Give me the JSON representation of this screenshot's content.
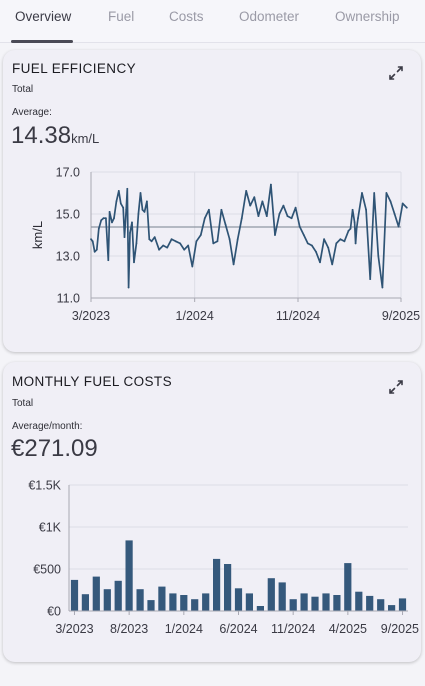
{
  "tabs": [
    "Overview",
    "Fuel",
    "Costs",
    "Odometer",
    "Ownership"
  ],
  "colors": {
    "line": "#2f5475",
    "bar": "#35597c",
    "avg": "#8e96a2",
    "grid": "#dcdce6",
    "axis": "#a9a9b3"
  },
  "efficiency": {
    "title": "FUEL EFFICIENCY",
    "scope": "Total",
    "avg_label": "Average:",
    "avg_value": "14.38",
    "avg_unit": "km/L",
    "expand_icon": "expand-icon"
  },
  "costs": {
    "title": "MONTHLY FUEL COSTS",
    "scope": "Total",
    "avg_label": "Average/month:",
    "avg_value": "€271.09",
    "expand_icon": "expand-icon"
  },
  "chart_data": [
    {
      "type": "line",
      "ylabel": "km/L",
      "ylim": [
        11.0,
        17.0
      ],
      "yticks": [
        "11.0",
        "13.0",
        "15.0",
        "17.0"
      ],
      "xticks": [
        "3/2023",
        "1/2024",
        "11/2024",
        "9/2025"
      ],
      "x_range": [
        "2023-03",
        "2025-09"
      ],
      "average": 14.38,
      "grid": true,
      "series": [
        {
          "x": [
            "2023-03-01",
            "2023-03-06",
            "2023-03-12",
            "2023-03-18",
            "2023-03-24",
            "2023-03-31",
            "2023-04-07",
            "2023-04-14",
            "2023-04-21",
            "2023-04-25",
            "2023-05-02",
            "2023-05-08",
            "2023-05-15",
            "2023-05-22",
            "2023-05-28",
            "2023-06-04",
            "2023-06-08",
            "2023-06-13",
            "2023-06-16",
            "2023-06-20",
            "2023-06-24",
            "2023-06-30",
            "2023-07-06",
            "2023-07-13",
            "2023-07-19",
            "2023-07-25",
            "2023-07-31",
            "2023-08-06",
            "2023-08-13",
            "2023-08-20",
            "2023-08-27",
            "2023-09-05",
            "2023-09-18",
            "2023-09-30",
            "2023-10-12",
            "2023-10-25",
            "2023-11-06",
            "2023-11-19",
            "2023-12-01",
            "2023-12-13",
            "2023-12-25",
            "2024-01-06",
            "2024-01-19",
            "2024-01-31",
            "2024-02-12",
            "2024-02-25",
            "2024-03-08",
            "2024-03-20",
            "2024-04-01",
            "2024-04-13",
            "2024-04-25",
            "2024-05-07",
            "2024-05-19",
            "2024-06-01",
            "2024-06-13",
            "2024-06-25",
            "2024-07-07",
            "2024-07-19",
            "2024-08-01",
            "2024-08-13",
            "2024-08-25",
            "2024-09-07",
            "2024-09-19",
            "2024-10-01",
            "2024-10-13",
            "2024-10-25",
            "2024-11-06",
            "2024-11-18",
            "2024-11-30",
            "2024-12-12",
            "2024-12-24",
            "2025-01-05",
            "2025-01-17",
            "2025-01-29",
            "2025-02-10",
            "2025-02-22",
            "2025-03-06",
            "2025-03-18",
            "2025-03-30",
            "2025-04-05",
            "2025-04-11",
            "2025-04-17",
            "2025-04-20",
            "2025-04-23",
            "2025-04-27",
            "2025-05-09",
            "2025-05-21",
            "2025-06-02",
            "2025-06-14",
            "2025-06-26",
            "2025-07-08",
            "2025-07-20",
            "2025-08-01",
            "2025-08-13",
            "2025-08-25",
            "2025-09-06",
            "2025-09-18"
          ],
          "y": [
            13.8,
            13.7,
            13.2,
            13.3,
            14.3,
            14.7,
            14.8,
            14.8,
            12.8,
            15.1,
            14.6,
            14.8,
            15.6,
            16.1,
            15.5,
            15.3,
            13.9,
            15.2,
            16.2,
            11.5,
            14.1,
            14.6,
            12.7,
            13.6,
            15.0,
            16.0,
            15.2,
            15.1,
            15.6,
            13.8,
            13.7,
            13.9,
            13.3,
            13.5,
            13.4,
            13.8,
            13.7,
            13.6,
            13.3,
            13.5,
            12.5,
            13.7,
            14.0,
            14.8,
            15.2,
            13.6,
            13.7,
            15.2,
            14.5,
            13.8,
            12.6,
            13.8,
            14.8,
            16.1,
            15.4,
            15.8,
            14.9,
            15.6,
            14.9,
            16.4,
            14.0,
            15.0,
            15.4,
            14.9,
            14.8,
            15.3,
            14.4,
            14.0,
            13.6,
            13.5,
            13.2,
            12.7,
            13.8,
            13.4,
            12.6,
            13.6,
            13.8,
            13.7,
            14.2,
            14.3,
            15.2,
            14.6,
            13.6,
            14.3,
            14.8,
            16.0,
            15.2,
            11.9,
            16.0,
            13.0,
            11.5,
            16.0,
            15.6,
            15.0,
            14.4,
            15.5,
            15.3
          ]
        }
      ]
    },
    {
      "type": "bar",
      "ylim": [
        0,
        1500
      ],
      "yticks": [
        "€0",
        "€500",
        "€1K",
        "€1.5K"
      ],
      "xticks": [
        "3/2023",
        "8/2023",
        "1/2024",
        "6/2024",
        "11/2024",
        "4/2025",
        "9/2025"
      ],
      "grid": true,
      "categories": [
        "2023-03",
        "2023-04",
        "2023-05",
        "2023-06",
        "2023-07",
        "2023-08",
        "2023-09",
        "2023-10",
        "2023-11",
        "2023-12",
        "2024-01",
        "2024-02",
        "2024-03",
        "2024-04",
        "2024-05",
        "2024-06",
        "2024-07",
        "2024-08",
        "2024-09",
        "2024-10",
        "2024-11",
        "2024-12",
        "2025-01",
        "2025-02",
        "2025-03",
        "2025-04",
        "2025-05",
        "2025-06",
        "2025-07",
        "2025-08",
        "2025-09"
      ],
      "values": [
        370,
        200,
        410,
        260,
        360,
        840,
        260,
        130,
        290,
        210,
        190,
        140,
        210,
        620,
        560,
        270,
        210,
        60,
        390,
        340,
        140,
        210,
        170,
        210,
        190,
        570,
        230,
        180,
        140,
        70,
        150
      ]
    }
  ]
}
